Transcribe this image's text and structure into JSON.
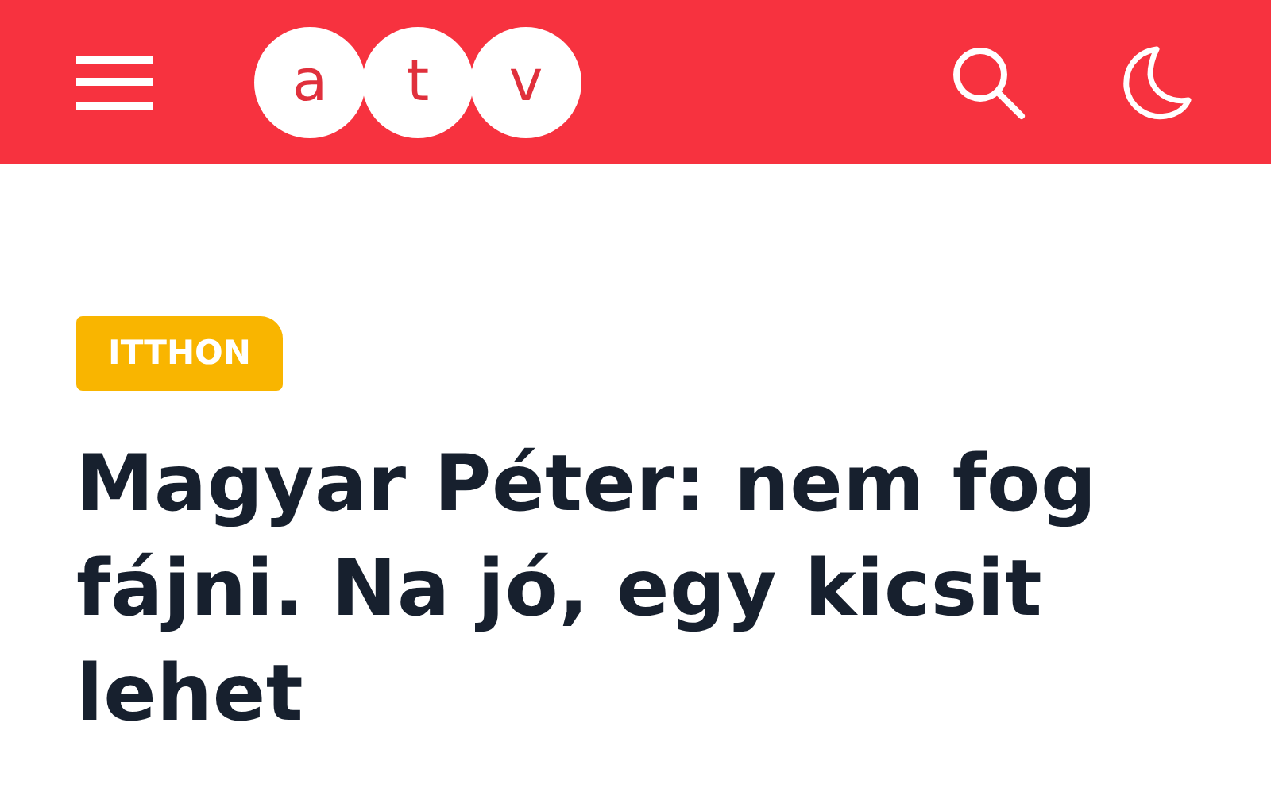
{
  "header": {
    "logo_letters": [
      "a",
      "t",
      "v"
    ]
  },
  "article": {
    "category": "ITTHON",
    "title": "Magyar Péter: nem fog fájni. Na jó, egy kicsit lehet"
  }
}
